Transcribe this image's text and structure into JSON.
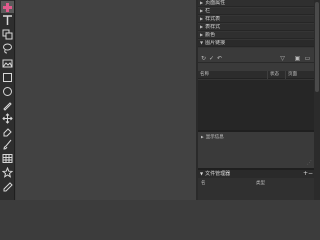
{
  "toolbar": {
    "tools": [
      {
        "icon": "plus-icon"
      },
      {
        "icon": "text-icon"
      },
      {
        "icon": "copy-icon"
      },
      {
        "icon": "lasso-icon"
      },
      {
        "icon": "image-icon"
      },
      {
        "icon": "rectangle-icon"
      },
      {
        "icon": "ellipse-icon"
      },
      {
        "icon": "pen-icon"
      },
      {
        "icon": "move-icon"
      },
      {
        "icon": "eraser-icon"
      },
      {
        "icon": "brush-icon"
      },
      {
        "icon": "table-icon"
      },
      {
        "icon": "star-icon"
      },
      {
        "icon": "eyedropper-icon"
      }
    ]
  },
  "panel": {
    "sections": [
      {
        "label": "页面属性",
        "arrow": "▶"
      },
      {
        "label": "栏",
        "arrow": "▶"
      },
      {
        "label": "样式表",
        "arrow": "▶"
      },
      {
        "label": "表样式",
        "arrow": "▶"
      },
      {
        "label": "颜色",
        "arrow": "▶"
      },
      {
        "label": "图片链接",
        "arrow": "▼"
      }
    ],
    "table_headers": {
      "name": "名称",
      "status": "状态",
      "page": "页面"
    },
    "sub_section": {
      "label": "显示信息",
      "arrow": "▶"
    },
    "layers_section": {
      "label": "文件管理器",
      "arrow": "▼",
      "plus": "+",
      "minus": "−"
    },
    "list_headers": {
      "col1": "名",
      "col2": "类型"
    }
  },
  "colors": {
    "accent": "#e05a8c",
    "canvas": "#424242",
    "panel": "#353535"
  }
}
